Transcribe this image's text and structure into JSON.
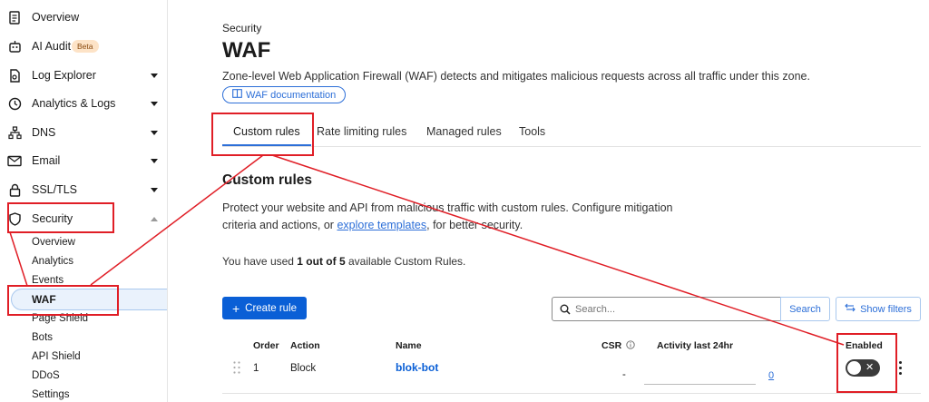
{
  "sidebar": {
    "items": [
      {
        "label": "Overview",
        "icon": "document-icon"
      },
      {
        "label": "AI Audit",
        "icon": "robot-icon",
        "badge": "Beta"
      },
      {
        "label": "Log Explorer",
        "icon": "log-icon"
      },
      {
        "label": "Analytics & Logs",
        "icon": "clock-icon"
      },
      {
        "label": "DNS",
        "icon": "network-icon"
      },
      {
        "label": "Email",
        "icon": "email-icon"
      },
      {
        "label": "SSL/TLS",
        "icon": "lock-icon"
      },
      {
        "label": "Security",
        "icon": "shield-icon"
      }
    ],
    "security_sub": [
      "Overview",
      "Analytics",
      "Events",
      "WAF",
      "Page Shield",
      "Bots",
      "API Shield",
      "DDoS",
      "Settings"
    ]
  },
  "header": {
    "breadcrumb": "Security",
    "title": "WAF",
    "description": "Zone-level Web Application Firewall (WAF) detects and mitigates malicious requests across all traffic under this zone.",
    "doc_button": "WAF documentation"
  },
  "tabs": [
    "Custom rules",
    "Rate limiting rules",
    "Managed rules",
    "Tools"
  ],
  "section": {
    "title": "Custom rules",
    "desc_1": "Protect your website and API from malicious traffic with custom rules. Configure mitigation criteria and actions, or ",
    "desc_link": "explore templates",
    "desc_2": ", for better security.",
    "usage_pre": "You have used ",
    "usage_bold": "1 out of 5",
    "usage_post": " available Custom Rules."
  },
  "toolbar": {
    "create_label": "Create rule",
    "search_placeholder": "Search...",
    "search_button": "Search",
    "filters_button": "Show filters"
  },
  "table": {
    "headers": {
      "order": "Order",
      "action": "Action",
      "name": "Name",
      "csr": "CSR",
      "activity": "Activity last 24hr",
      "enabled": "Enabled"
    },
    "rows": [
      {
        "order": "1",
        "action": "Block",
        "name": "blok-bot",
        "csr": "-",
        "activity": "0",
        "enabled": false
      }
    ]
  },
  "colors": {
    "accent": "#0a5fd6",
    "annotation": "#e01e26"
  }
}
